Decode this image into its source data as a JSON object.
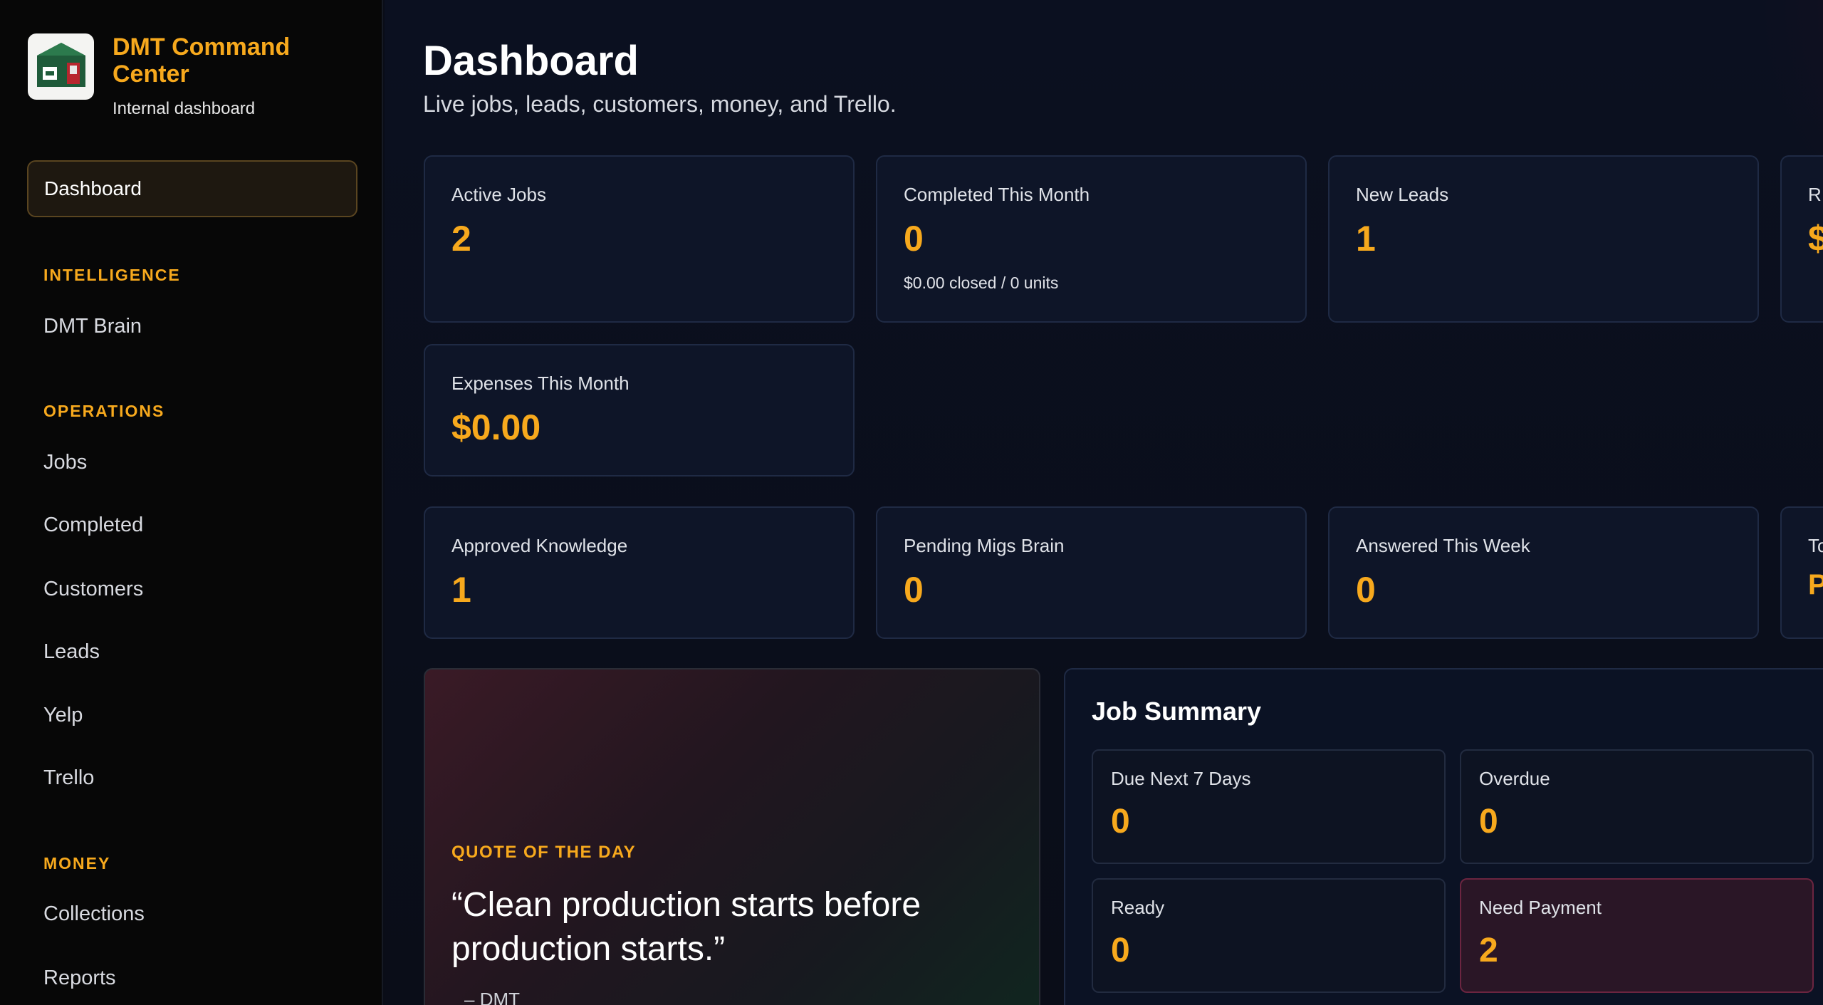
{
  "brand": {
    "title": "DMT Command Center",
    "subtitle": "Internal dashboard"
  },
  "sidebar": {
    "active_item": "Dashboard",
    "sections": [
      {
        "heading": "INTELLIGENCE",
        "items": [
          "DMT Brain"
        ]
      },
      {
        "heading": "OPERATIONS",
        "items": [
          "Jobs",
          "Completed",
          "Customers",
          "Leads",
          "Yelp",
          "Trello"
        ]
      },
      {
        "heading": "MONEY",
        "items": [
          "Collections",
          "Reports"
        ]
      }
    ]
  },
  "header": {
    "title": "Dashboard",
    "subtitle": "Live jobs, leads, customers, money, and Trello."
  },
  "stats_row1": [
    {
      "label": "Active Jobs",
      "value": "2"
    },
    {
      "label": "Completed This Month",
      "value": "0",
      "note": "$0.00 closed / 0 units"
    },
    {
      "label": "New Leads",
      "value": "1"
    },
    {
      "label": "R",
      "value": "$"
    }
  ],
  "stats_row2": [
    {
      "label": "Expenses This Month",
      "value": "$0.00"
    }
  ],
  "brain_stats": [
    {
      "label": "Approved Knowledge",
      "value": "1"
    },
    {
      "label": "Pending Migs Brain",
      "value": "0"
    },
    {
      "label": "Answered This Week",
      "value": "0"
    },
    {
      "label": "To",
      "value": "P"
    }
  ],
  "quote": {
    "heading": "QUOTE OF THE DAY",
    "text": "“Clean production starts before production starts.”",
    "author": "DMT"
  },
  "job_summary": {
    "title": "Job Summary",
    "items": [
      {
        "label": "Due Next 7 Days",
        "value": "0"
      },
      {
        "label": "Overdue",
        "value": "0"
      },
      {
        "label": "Ready",
        "value": "0"
      },
      {
        "label": "Need Payment",
        "value": "2"
      }
    ]
  },
  "colors": {
    "accent": "#f7a91d",
    "card_bg": "#0e1528",
    "sidebar_bg": "#070707",
    "alert_bg": "#2a1626"
  }
}
